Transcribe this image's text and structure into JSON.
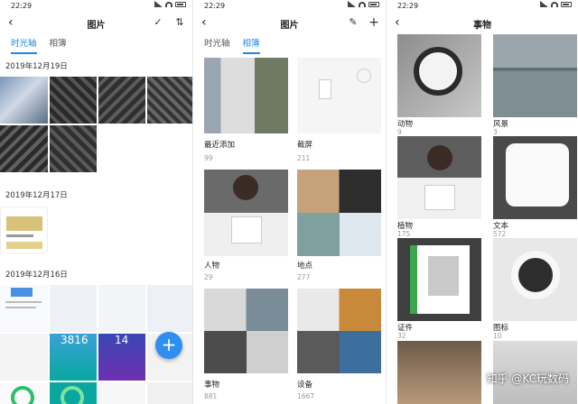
{
  "status": {
    "time": "22:29"
  },
  "screen1": {
    "title": "图片",
    "tabs": [
      "时光轴",
      "相簿"
    ],
    "dates": [
      "2019年12月19日",
      "2019年12月17日",
      "2019年12月16日"
    ],
    "tile_text_a": "3816",
    "tile_text_b": "14",
    "fab_label": "+"
  },
  "screen2": {
    "title": "图片",
    "tabs": [
      "时光轴",
      "相簿"
    ],
    "albums": [
      {
        "name": "最近添加",
        "count": "99"
      },
      {
        "name": "截屏",
        "count": "211"
      },
      {
        "name": "人物",
        "count": "29"
      },
      {
        "name": "地点",
        "count": "277"
      },
      {
        "name": "事物",
        "count": "881"
      },
      {
        "name": "设备",
        "count": "1667"
      }
    ]
  },
  "screen3": {
    "title": "事物",
    "albums": [
      {
        "name": "动物",
        "count": "9"
      },
      {
        "name": "风景",
        "count": "3"
      },
      {
        "name": "植物",
        "count": "175"
      },
      {
        "name": "文本",
        "count": "572"
      },
      {
        "name": "证件",
        "count": "32"
      },
      {
        "name": "图标",
        "count": "10"
      }
    ],
    "watermark": "知乎 @KC玩数码"
  },
  "icons": {
    "back": "chevron-left-icon",
    "select": "check-circle-icon",
    "sort": "sort-icon",
    "edit": "edit-icon",
    "add": "plus-icon"
  }
}
